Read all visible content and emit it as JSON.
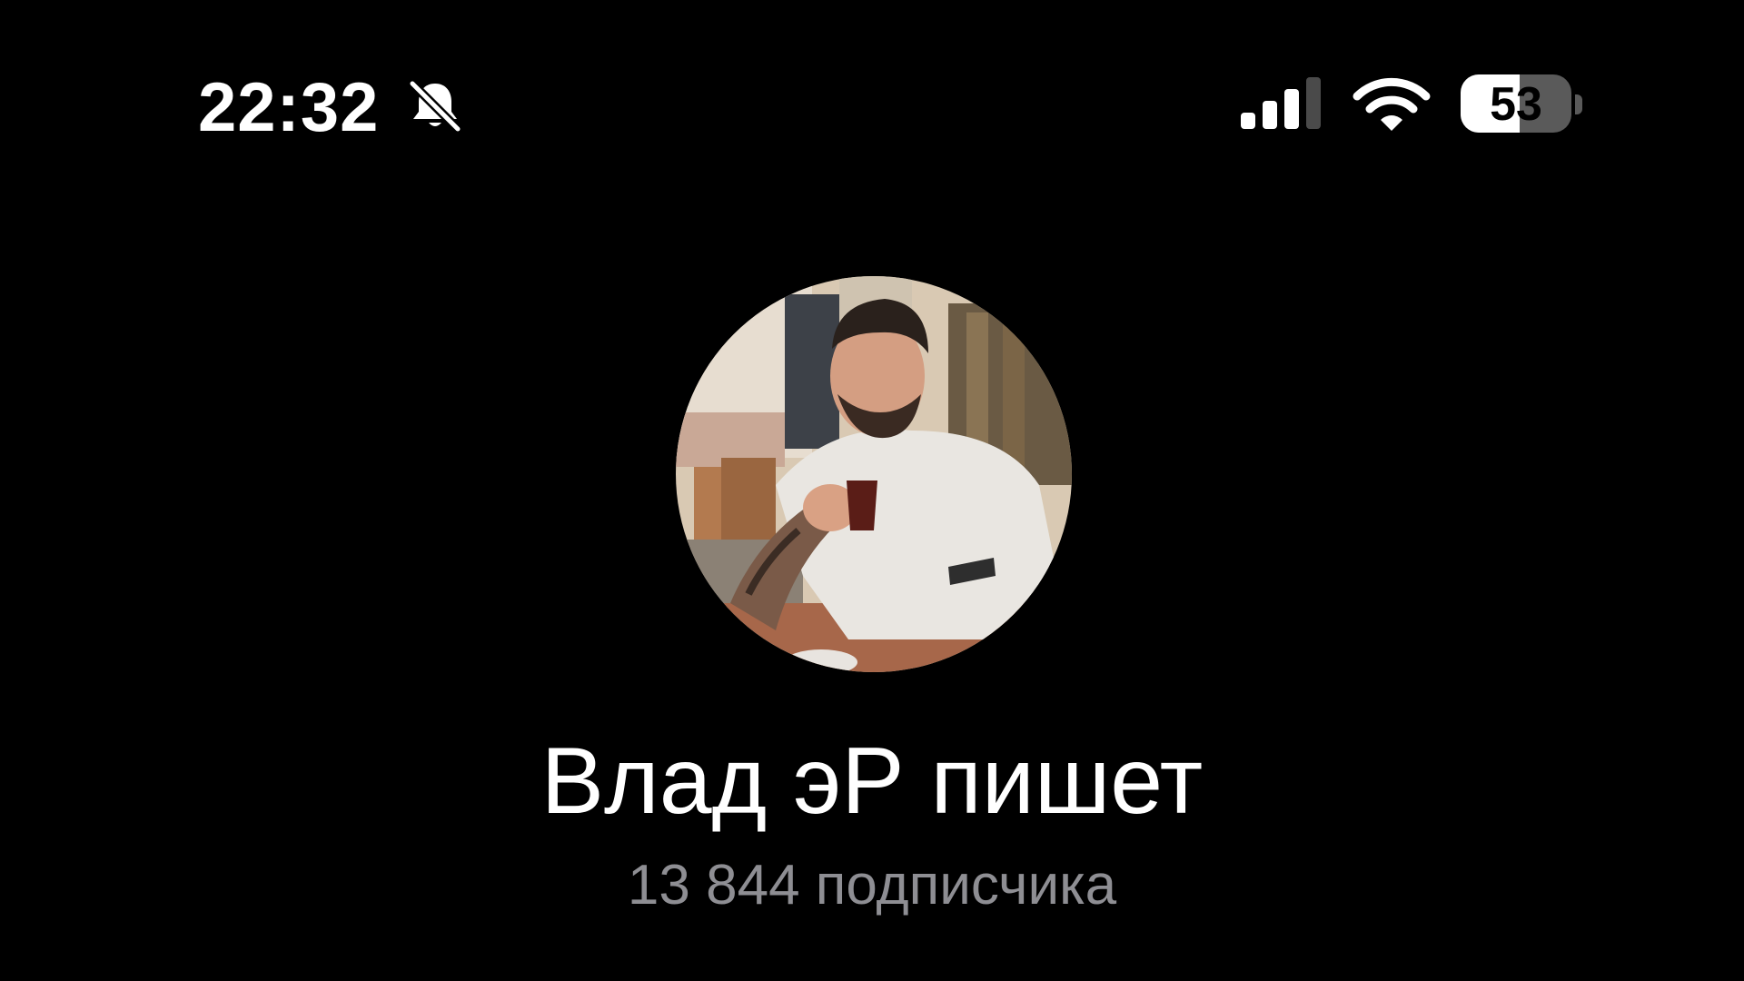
{
  "status_bar": {
    "time": "22:32",
    "mute_icon": "bell-slash-icon",
    "signal_icon": "cellular-signal-icon",
    "signal_bars_active": 3,
    "signal_bars_total": 4,
    "wifi_icon": "wifi-icon",
    "battery_percent": "53",
    "battery_level": 0.53
  },
  "profile": {
    "avatar_icon": "channel-avatar-photo",
    "title": "Влад эР пишет",
    "subscribers": "13 844 подписчика"
  },
  "colors": {
    "background": "#000000",
    "text_primary": "#ffffff",
    "text_secondary": "#8e8e93",
    "battery_empty": "#5a5a5a"
  }
}
